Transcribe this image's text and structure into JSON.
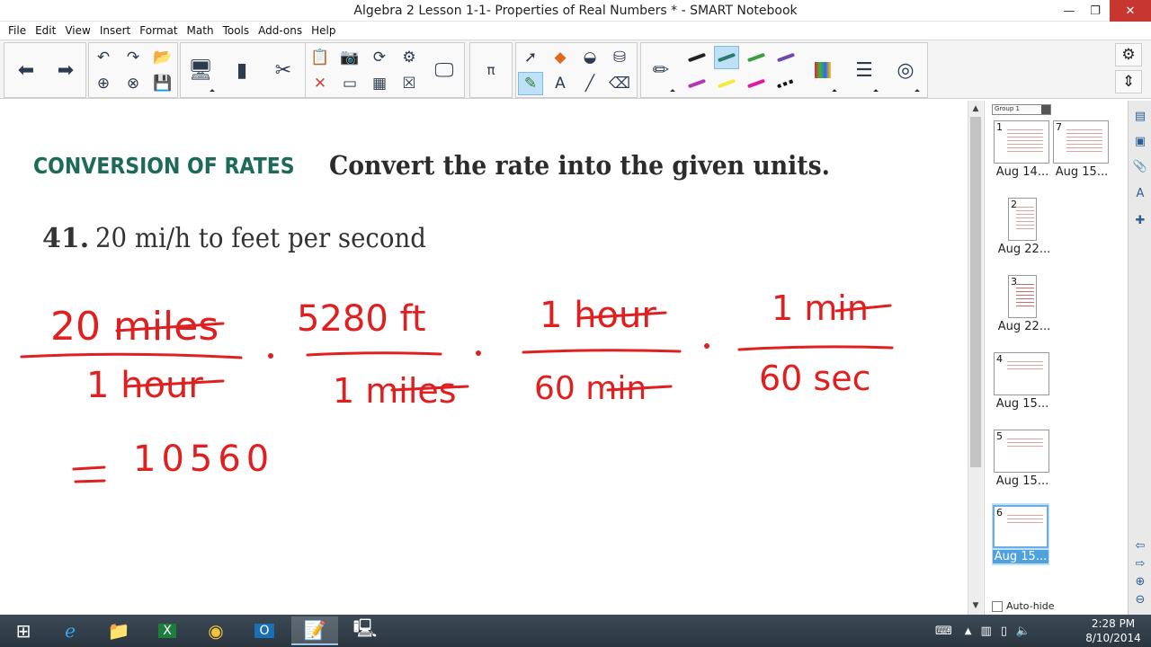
{
  "window": {
    "title": "Algebra 2 Lesson 1-1- Properties of Real Numbers * - SMART Notebook",
    "minimize": "—",
    "maximize": "❐",
    "close": "✕"
  },
  "menu": [
    "File",
    "Edit",
    "View",
    "Insert",
    "Format",
    "Math",
    "Tools",
    "Add-ons",
    "Help"
  ],
  "page": {
    "heading_section": "CONVERSION OF RATES",
    "heading_instruction": "Convert the rate into the given units.",
    "question_number": "41.",
    "question_text": "20 mi/h to feet per second",
    "ink": {
      "frac1_num": "20 miles",
      "frac1_den": "1 hour",
      "frac2_num": "5280 ft",
      "frac2_den": "1 miles",
      "frac3_num": "1 hour",
      "frac3_den": "60 min",
      "frac4_num": "1 min",
      "frac4_den": "60 sec",
      "result": "= 10560"
    },
    "ink_color": "#e02020"
  },
  "sorter": {
    "group_label": "Group 1",
    "pages": [
      {
        "num": "1",
        "label": "Aug 14..."
      },
      {
        "num": "7",
        "label": "Aug 15..."
      },
      {
        "num": "2",
        "label": "Aug 22..."
      },
      {
        "num": "3",
        "label": "Aug 22..."
      },
      {
        "num": "4",
        "label": "Aug 15..."
      },
      {
        "num": "5",
        "label": "Aug 15..."
      },
      {
        "num": "6",
        "label": "Aug 15..."
      }
    ],
    "autohide_label": "Auto-hide"
  },
  "taskbar": {
    "time": "2:28 PM",
    "date": "8/10/2014"
  },
  "colors": {
    "heading_green": "#1d6b57",
    "selection_blue": "#bfe1f7",
    "close_red": "#c7372f"
  }
}
